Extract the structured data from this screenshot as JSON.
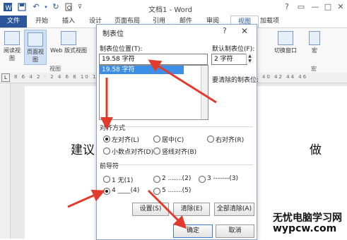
{
  "app": {
    "window_title": "文档1 - Word"
  },
  "quick_access": {
    "save_icon": "save-icon",
    "undo_icon": "undo-icon",
    "redo_icon": "redo-icon",
    "customize_icon": "chevron-down-icon"
  },
  "window_buttons": {
    "help": "?",
    "restore": "▭",
    "minimize": "—",
    "maximize": "□",
    "close": "✕"
  },
  "tabs": [
    "文件",
    "开始",
    "插入",
    "设计",
    "页面布局",
    "引用",
    "邮件",
    "审阅",
    "视图",
    "加载项"
  ],
  "active_tab": "视图",
  "ribbon": {
    "read_mode": "阅读视图",
    "print_layout": "页面视图",
    "web_layout": "Web 版式视图",
    "group_view_label": "视图",
    "switch_window": "切换窗口",
    "macros": "宏",
    "group_macro_label": "宏"
  },
  "ruler": {
    "numbers": "8 6 4 2 · 2 4 6 8 10 12 14 16 18 20 22 24 26 28 30 32 34 36 38 40 42 44 46"
  },
  "document": {
    "text_left": "建议",
    "text_right": "做"
  },
  "dialog": {
    "title": "制表位",
    "help": "?",
    "close": "✕",
    "tab_stop_position_label": "制表位位置(T):",
    "tab_stop_position_value": "19.58 字符",
    "list_items": [
      "19.58 字符"
    ],
    "default_tab_stops_label": "默认制表位(F):",
    "default_tab_stops_value": "2 字符",
    "tab_stops_to_clear_label": "要清除的制表位:",
    "alignment_label": "对齐方式",
    "alignment_options": [
      {
        "label": "左对齐(L)",
        "checked": true
      },
      {
        "label": "居中(C)",
        "checked": false
      },
      {
        "label": "右对齐(R)",
        "checked": false
      },
      {
        "label": "小数点对齐(D)",
        "checked": false
      },
      {
        "label": "竖线对齐(B)",
        "checked": false
      }
    ],
    "leader_label": "前导符",
    "leader_options": [
      {
        "label": "1 无(1)",
        "checked": false
      },
      {
        "label": "2 .......(2)",
        "checked": false
      },
      {
        "label": "3 -------(3)",
        "checked": false
      },
      {
        "label": "4 ____(4)",
        "checked": true
      },
      {
        "label": "5 .......(5)",
        "checked": false
      }
    ],
    "set_button": "设置(S)",
    "clear_button": "清除(E)",
    "clear_all_button": "全部清除(A)",
    "ok_button": "确定",
    "cancel_button": "取消"
  },
  "watermark": {
    "line1": "无忧电脑学习网",
    "line2": "wypcw.com"
  },
  "colors": {
    "accent": "#2b579a",
    "arrow": "#e23b2e",
    "selection": "#3d8ee6"
  }
}
